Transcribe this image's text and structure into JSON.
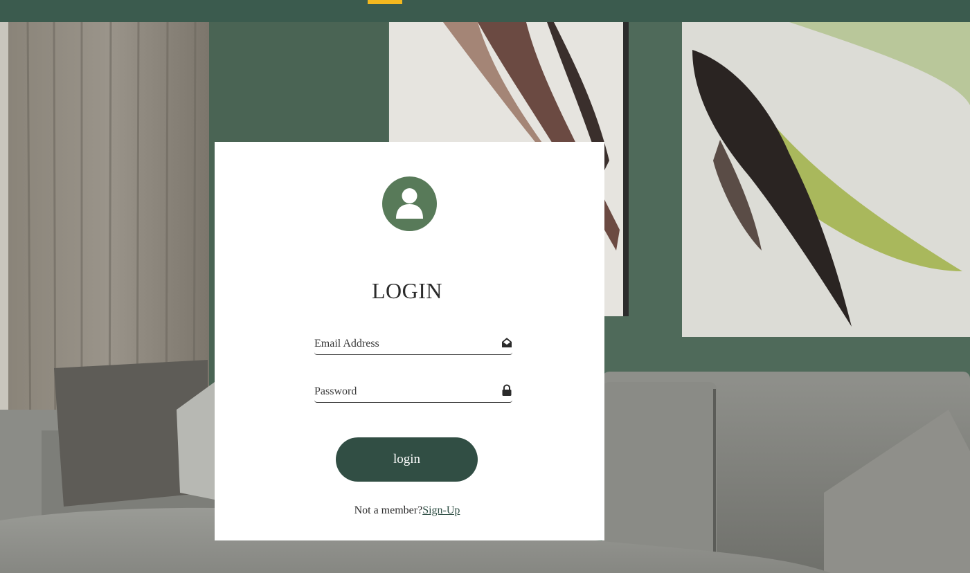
{
  "colors": {
    "topbar": "#3b5b4e",
    "topbar_accent": "#f4b81e",
    "avatar": "#587a59",
    "button": "#314e44",
    "button_text": "#ffffff"
  },
  "icons": {
    "avatar": "user-icon",
    "email": "envelope-open-icon",
    "password": "lock-icon"
  },
  "login": {
    "title": "LOGIN",
    "email_placeholder": "Email Address",
    "password_placeholder": "Password",
    "email_value": "",
    "password_value": "",
    "button_label": "login",
    "not_member_text": "Not a member?",
    "signup_link": "Sign-Up"
  }
}
